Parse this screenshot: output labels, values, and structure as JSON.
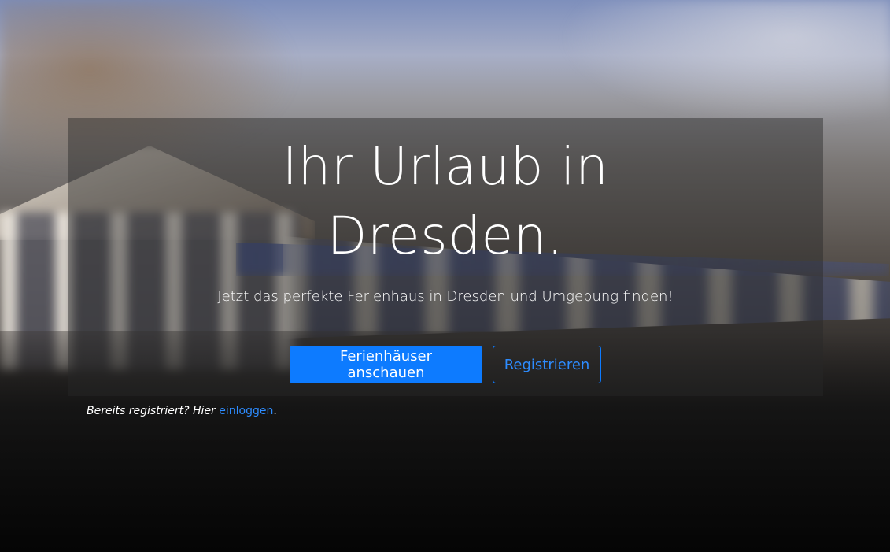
{
  "hero": {
    "headline_line1": "Ihr Urlaub in",
    "headline_line2": "Dresden.",
    "subline": "Jetzt das perfekte Ferienhaus in Dresden und Umgebung finden!",
    "primary_button": "Ferienhäuser anschauen",
    "secondary_button": "Registrieren"
  },
  "login": {
    "prefix": "Bereits registriert? Hier ",
    "link": "einloggen",
    "suffix": "."
  },
  "colors": {
    "accent": "#0d7bff",
    "text": "#ffffff",
    "panel": "rgba(40,40,40,0.45)"
  }
}
